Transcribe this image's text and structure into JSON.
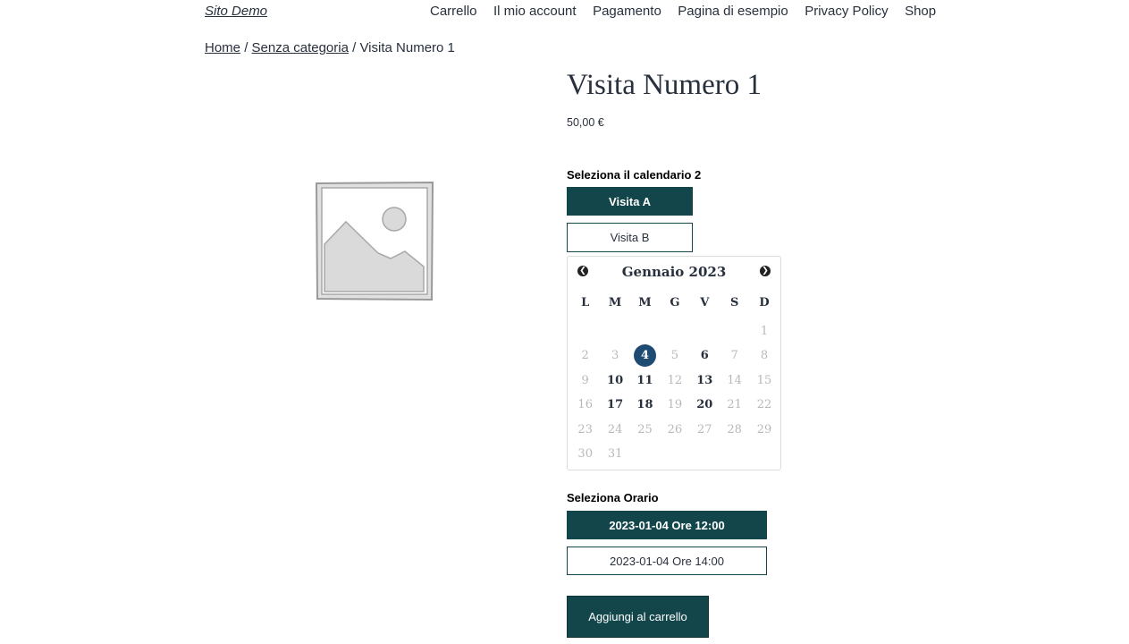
{
  "site": {
    "title": "Sito Demo"
  },
  "nav": {
    "items": [
      "Carrello",
      "Il mio account",
      "Pagamento",
      "Pagina di esempio",
      "Privacy Policy",
      "Shop"
    ]
  },
  "breadcrumb": {
    "home": "Home",
    "category": "Senza categoria",
    "current": "Visita Numero 1",
    "separator": "/"
  },
  "product": {
    "title": "Visita Numero 1",
    "price": "50,00 €",
    "image_icon": "image-placeholder-icon"
  },
  "calendar_select": {
    "label": "Seleziona il calendario 2",
    "options": [
      "Visita A",
      "Visita B"
    ],
    "selected": "Visita A"
  },
  "calendar": {
    "month_label": "Gennaio 2023",
    "prev_icon": "chevron-left-icon",
    "next_icon": "chevron-right-icon",
    "weekdays": [
      "L",
      "M",
      "M",
      "G",
      "V",
      "S",
      "D"
    ],
    "leading_blanks": 6,
    "days": [
      "1",
      "2",
      "3",
      "4",
      "5",
      "6",
      "7",
      "8",
      "9",
      "10",
      "11",
      "12",
      "13",
      "14",
      "15",
      "16",
      "17",
      "18",
      "19",
      "20",
      "21",
      "22",
      "23",
      "24",
      "25",
      "26",
      "27",
      "28",
      "29",
      "30",
      "31"
    ],
    "available": [
      "4",
      "6",
      "10",
      "11",
      "13",
      "17",
      "18",
      "20"
    ],
    "selected": "4"
  },
  "time_select": {
    "label": "Seleziona Orario",
    "options": [
      "2023-01-04 Ore 12:00",
      "2023-01-04 Ore 14:00"
    ],
    "selected": "2023-01-04 Ore 12:00"
  },
  "cart": {
    "button_label": "Aggiungi al carrello"
  },
  "colors": {
    "primary": "#13464a",
    "selected_day": "#1f4a72",
    "text": "#28303d",
    "muted": "#b8b8b8"
  }
}
